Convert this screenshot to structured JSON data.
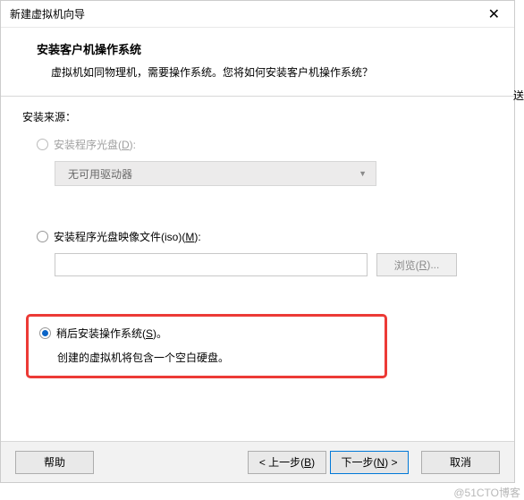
{
  "window": {
    "title": "新建虚拟机向导",
    "close": "✕"
  },
  "header": {
    "title": "安装客户机操作系统",
    "subtitle": "虚拟机如同物理机，需要操作系统。您将如何安装客户机操作系统？"
  },
  "content": {
    "source_label": "安装来源：",
    "option_disc": {
      "prefix": "安装程序光盘(",
      "hotkey": "D",
      "suffix": "):"
    },
    "dropdown": {
      "text": "无可用驱动器"
    },
    "option_iso": {
      "prefix": "安装程序光盘映像文件(iso)(",
      "hotkey": "M",
      "suffix": "):"
    },
    "browse": {
      "prefix": "浏览(",
      "hotkey": "R",
      "suffix": ")..."
    },
    "option_later": {
      "prefix": "稍后安装操作系统(",
      "hotkey": "S",
      "suffix": ")。"
    },
    "hint": "创建的虚拟机将包含一个空白硬盘。"
  },
  "buttons": {
    "help": "帮助",
    "back": {
      "prefix": "< 上一步(",
      "hotkey": "B",
      "suffix": ")"
    },
    "next": {
      "prefix": "下一步(",
      "hotkey": "N",
      "suffix": ") >"
    },
    "cancel": "取消"
  },
  "watermark": "@51CTO博客",
  "side": "送"
}
